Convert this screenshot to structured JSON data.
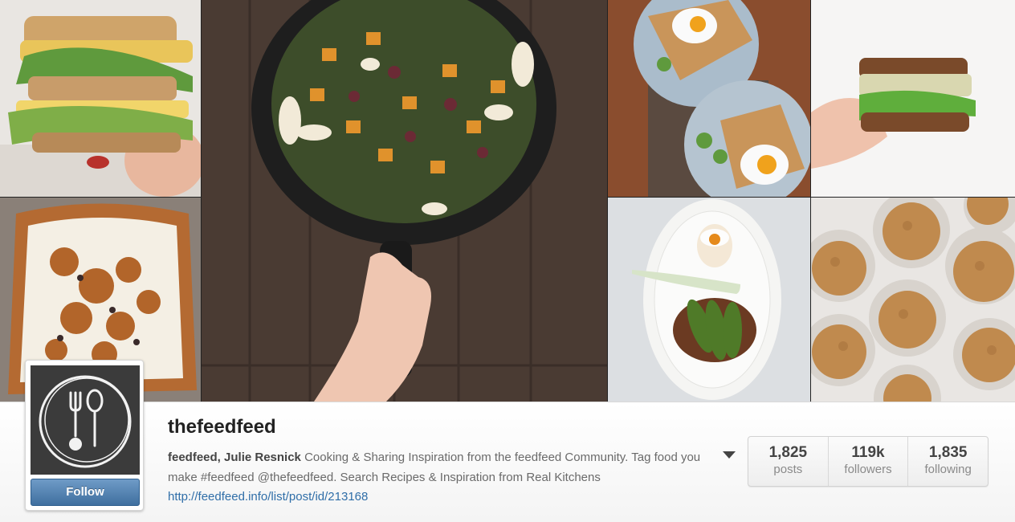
{
  "profile": {
    "username": "thefeedfeed",
    "follow_label": "Follow",
    "bio_name": "feedfeed, Julie Resnick",
    "bio_text": " Cooking & Sharing Inspiration from the feedfeed Community. Tag food you make #feedfeed @thefeedfeed. Search Recipes & Inspiration from Real Kitchens ",
    "bio_link": "http://feedfeed.info/list/post/id/213168",
    "avatar_icon": "spoon-fork-logo-icon",
    "menu_icon": "caret-down-icon"
  },
  "stats": [
    {
      "value": "1,825",
      "label": "posts"
    },
    {
      "value": "119k",
      "label": "followers"
    },
    {
      "value": "1,835",
      "label": "following"
    }
  ],
  "colors": {
    "follow_button": "#4a7bac",
    "link": "#2f6ea8",
    "avatar_bg": "#3b3b3b"
  },
  "photos": [
    {
      "subject": "sandwich-photo"
    },
    {
      "subject": "skillet-salad-photo"
    },
    {
      "subject": "egg-toast-plates-photo"
    },
    {
      "subject": "sprout-sandwich-photo"
    },
    {
      "subject": "walnut-toast-photo"
    },
    {
      "subject": "soft-egg-avocado-photo"
    },
    {
      "subject": "muffins-photo"
    }
  ]
}
